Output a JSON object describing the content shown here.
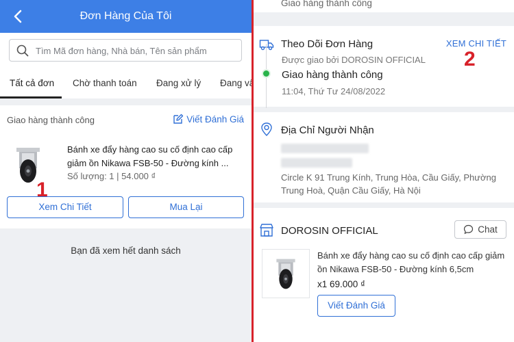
{
  "left": {
    "header": {
      "title": "Đơn Hàng Của Tôi"
    },
    "search": {
      "placeholder": "Tìm Mã đơn hàng, Nhà bán, Tên sản phẩm"
    },
    "tabs": [
      {
        "label": "Tất cả đơn"
      },
      {
        "label": "Chờ thanh toán"
      },
      {
        "label": "Đang xử lý"
      },
      {
        "label": "Đang vậ"
      }
    ],
    "order": {
      "status": "Giao hàng thành công",
      "review_label": "Viết Đánh Giá",
      "product_name": "Bánh xe đẩy hàng cao su cố định cao cấp giảm ồn Nikawa FSB-50 - Đường kính ...",
      "meta": "Số lượng: 1 | 54.000 ₫",
      "detail_button": "Xem Chi Tiết",
      "rebuy_button": "Mua Lại"
    },
    "marker": "1",
    "end_note": "Bạn đã xem hết danh sách"
  },
  "right": {
    "top_status": "Giao hàng thành công",
    "tracking": {
      "title": "Theo Dõi Đơn Hàng",
      "detail_link": "XEM CHI TIẾT",
      "delivered_by": "Được giao bởi DOROSIN OFFICIAL",
      "status": "Giao hàng thành công",
      "time": "11:04, Thứ Tư 24/08/2022"
    },
    "marker": "2",
    "address": {
      "title": "Địa Chỉ Người Nhận",
      "line1": "Circle K 91 Trung Kính, Trung Hòa, Cầu Giấy, Phường",
      "line2": "Trung Hoà, Quận Cầu Giấy, Hà Nội"
    },
    "shop": {
      "name": "DOROSIN OFFICIAL",
      "chat_label": "Chat",
      "product_name": "Bánh xe đẩy hàng cao su cố định cao cấp giảm ồn Nikawa FSB-50 - Đường kính 6,5cm",
      "qty_price": "x1  69.000 ₫",
      "review_button": "Viết Đánh Giá"
    }
  },
  "colors": {
    "header": "#3d7fe6",
    "accent": "#2f6fd6",
    "marker": "#d8222a",
    "delivered_dot": "#29b34a"
  }
}
